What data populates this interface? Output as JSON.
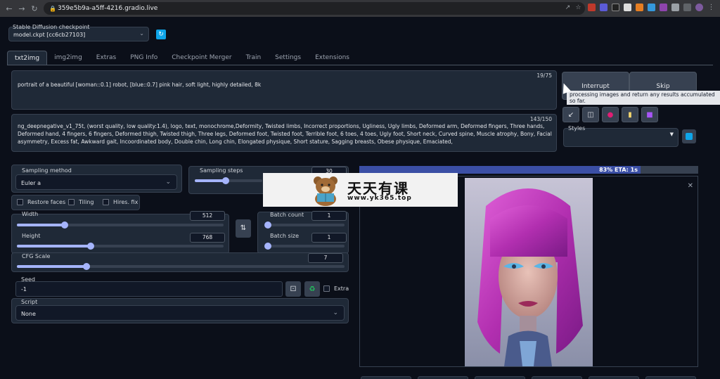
{
  "browser": {
    "url": "359e5b9a-a5ff-4216.gradio.live"
  },
  "checkpoint": {
    "label": "Stable Diffusion checkpoint",
    "value": "model.ckpt [cc6cb27103]"
  },
  "tabs": [
    {
      "label": "txt2img"
    },
    {
      "label": "img2img"
    },
    {
      "label": "Extras"
    },
    {
      "label": "PNG Info"
    },
    {
      "label": "Checkpoint Merger"
    },
    {
      "label": "Train"
    },
    {
      "label": "Settings"
    },
    {
      "label": "Extensions"
    }
  ],
  "prompt": {
    "text": "portrait of a beautiful [woman::0.1] robot, [blue::0.7] pink hair, soft light, highly detailed, 8k",
    "count": "19/75"
  },
  "negative_prompt": {
    "text": "ng_deepnegative_v1_75t, (worst quality, low quality:1.4), logo, text, monochrome,Deformity, Twisted limbs, Incorrect proportions, Ugliness, Ugly limbs, Deformed arm, Deformed fingers, Three hands, Deformed hand, 4 fingers, 6 fingers, Deformed thigh, Twisted thigh, Three legs, Deformed foot, Twisted foot, Terrible foot, 6 toes, 4 toes, Ugly foot, Short neck, Curved spine, Muscle atrophy, Bony, Facial asymmetry, Excess fat, Awkward gait, Incoordinated body, Double chin, Long chin, Elongated physique, Short stature, Sagging breasts, Obese physique, Emaciated,",
    "count": "143/150"
  },
  "actions": {
    "interrupt": "Interrupt",
    "skip": "Skip",
    "tooltip": "processing images and return any results accumulated so far."
  },
  "styles": {
    "label": "Styles"
  },
  "sampling": {
    "method_label": "Sampling method",
    "method_value": "Euler a",
    "steps_label": "Sampling steps",
    "steps_value": "30"
  },
  "options": {
    "restore_faces": "Restore faces",
    "tiling": "Tiling",
    "hires_fix": "Hires. fix"
  },
  "size": {
    "width_label": "Width",
    "width_value": "512",
    "height_label": "Height",
    "height_value": "768"
  },
  "batch": {
    "count_label": "Batch count",
    "count_value": "1",
    "size_label": "Batch size",
    "size_value": "1"
  },
  "cfg": {
    "label": "CFG Scale",
    "value": "7"
  },
  "seed": {
    "label": "Seed",
    "value": "-1",
    "extra_label": "Extra"
  },
  "script": {
    "label": "Script",
    "value": "None"
  },
  "progress": {
    "text": "83% ETA: 1s",
    "fraction": 0.83
  },
  "watermark": {
    "title": "天天有课",
    "url": "www.yk365.top"
  },
  "colors": {
    "accent": "#a5b4fc",
    "progress": "#3b4fa5",
    "refresh": "#0ea5e9"
  }
}
